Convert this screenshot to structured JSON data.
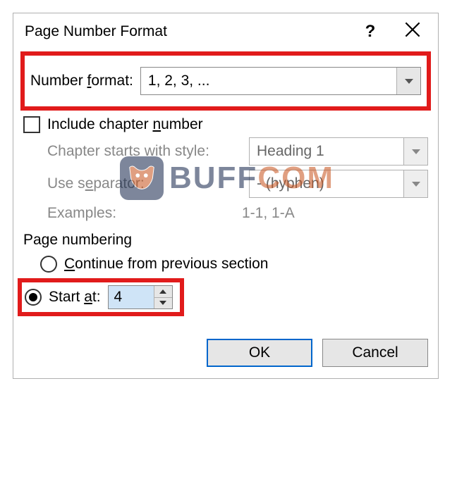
{
  "titlebar": {
    "title": "Page Number Format",
    "help": "?"
  },
  "format": {
    "label_pre": "Number ",
    "label_ul": "f",
    "label_post": "ormat:",
    "value": "1, 2, 3, ..."
  },
  "chapter": {
    "include_pre": "Include chapter ",
    "include_ul": "n",
    "include_post": "umber",
    "include_checked": false,
    "style_label": "Chapter starts with style:",
    "style_value": "Heading 1",
    "sep_label_pre": "Use s",
    "sep_label_ul": "e",
    "sep_label_post": "parator:",
    "sep_value": "-   (hyphen)",
    "examples_label": "Examples:",
    "examples_value": "1-1, 1-A"
  },
  "numbering": {
    "section_label": "Page numbering",
    "continue_pre": "",
    "continue_ul": "C",
    "continue_post": "ontinue from previous section",
    "start_pre": "Start ",
    "start_ul": "a",
    "start_post": "t:",
    "start_value": "4",
    "selected": "start"
  },
  "footer": {
    "ok": "OK",
    "cancel": "Cancel"
  },
  "watermark": {
    "text_a": "BUFF",
    "text_b": "COM"
  }
}
